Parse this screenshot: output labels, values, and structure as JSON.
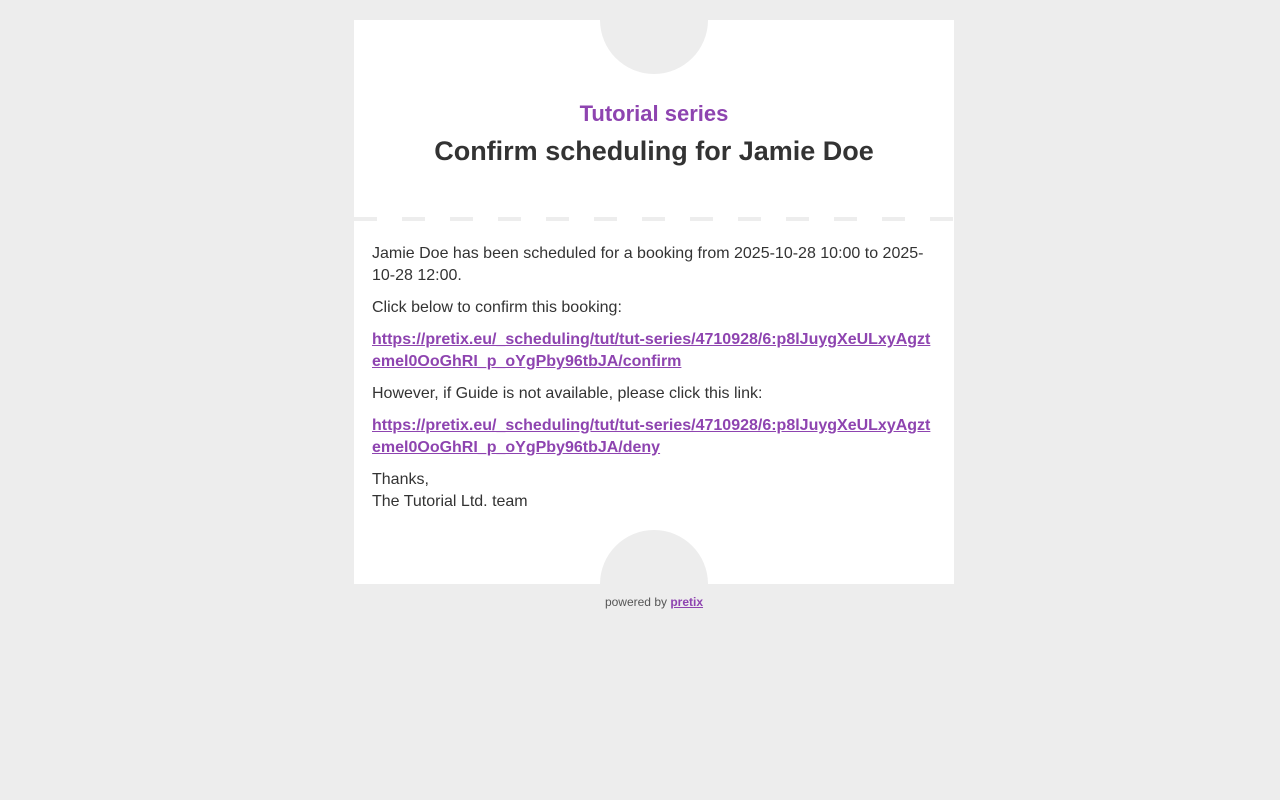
{
  "header": {
    "event_name": "Tutorial series",
    "title": "Confirm scheduling for Jamie Doe"
  },
  "body": {
    "intro_line": "Jamie Doe has been scheduled for a booking from 2025-10-28 10:00 to 2025-10-28 12:00.",
    "confirm_prompt": "Click below to confirm this booking:",
    "confirm_link": "https://pretix.eu/_scheduling/tut/tut-series/4710928/6:p8lJuygXeULxyAgztemel0OoGhRI_p_oYgPby96tbJA/confirm",
    "deny_prompt": "However, if Guide is not available, please click this link:",
    "deny_link": "https://pretix.eu/_scheduling/tut/tut-series/4710928/6:p8lJuygXeULxyAgztemel0OoGhRI_p_oYgPby96tbJA/deny",
    "signoff_thanks": "Thanks,",
    "signoff_team": "The Tutorial Ltd. team"
  },
  "footer": {
    "powered_by": "powered by",
    "brand_link": "pretix"
  },
  "colors": {
    "accent": "#8e44b0",
    "background": "#ededed",
    "card": "#ffffff",
    "text": "#333333"
  }
}
